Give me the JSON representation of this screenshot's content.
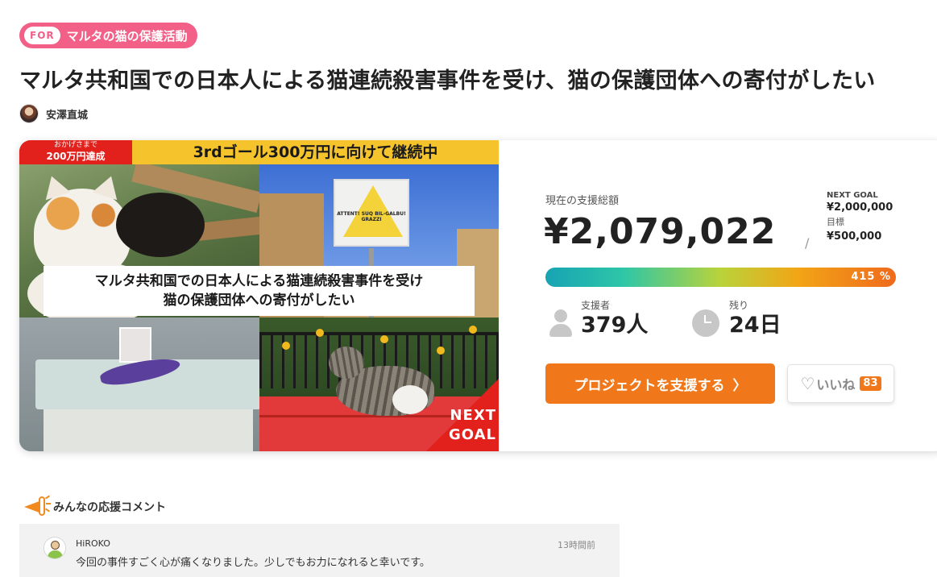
{
  "category": {
    "for_label": "FOR",
    "name": "マルタの猫の保護活動"
  },
  "project": {
    "title": "マルタ共和国での日本人による猫連続殺害事件を受け、猫の保護団体への寄付がしたい",
    "owner": "安澤直城"
  },
  "hero": {
    "banner_left_line1": "おかげさまで",
    "banner_left_line2": "200万円達成",
    "banner_right": "3rdゴール300万円に向けて継続中",
    "sign_text": "ATTENT! SUQ BIL-GALBU! GRAZZI",
    "caption_line1": "マルタ共和国での日本人による猫連続殺害事件を受け",
    "caption_line2": "猫の保護団体への寄付がしたい",
    "next_goal_line1": "NEXT",
    "next_goal_line2": "GOAL"
  },
  "funding": {
    "total_label": "現在の支援総額",
    "total_amount": "¥2,079,022",
    "separator": "/",
    "next_goal_label": "NEXT GOAL",
    "next_goal_amount": "¥2,000,000",
    "target_label": "目標",
    "target_amount": "¥500,000",
    "progress_percent": 415,
    "progress_label": "415 %"
  },
  "stats": {
    "supporters_label": "支援者",
    "supporters_value": "379人",
    "remaining_label": "残り",
    "remaining_value": "24日"
  },
  "actions": {
    "support_label": "プロジェクトを支援する",
    "support_chevron": "〉",
    "like_label": "いいね",
    "like_count": "83"
  },
  "comments": {
    "section_title": "みんなの応援コメント",
    "items": [
      {
        "name": "HiROKO",
        "time": "13時間前",
        "text": "今回の事件すごく心が痛くなりました。少しでもお力になれると幸いです。"
      }
    ]
  },
  "colors": {
    "accent": "#f0781a",
    "tag": "#f25f87",
    "banner_red": "#e2211c",
    "banner_yellow": "#f5c42d"
  },
  "icons": [
    "person-icon",
    "clock-icon",
    "heart-icon",
    "megaphone-icon",
    "chevron-right-icon"
  ]
}
